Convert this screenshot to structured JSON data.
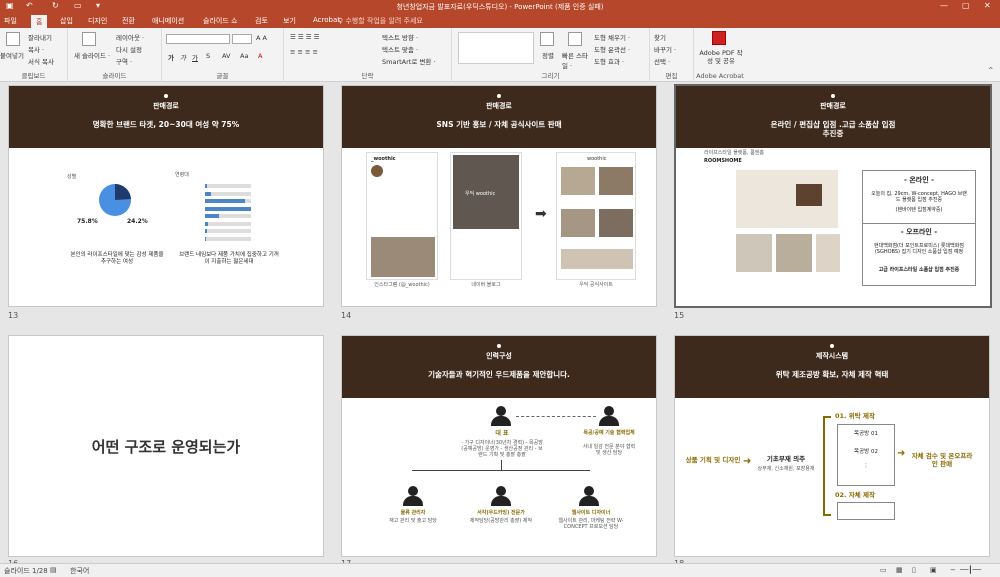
{
  "window": {
    "title": "청년창업자금 발표자료(우딕스튜디오) - PowerPoint (제품 인증 실패)"
  },
  "tabs": [
    "파일",
    "홈",
    "삽입",
    "디자인",
    "전환",
    "애니메이션",
    "슬라이드 쇼",
    "검토",
    "보기",
    "Acrobat"
  ],
  "tell_me": "♀ 수행할 작업을 알려 주세요",
  "ribbon": {
    "clipboard": {
      "cut": "잘라내기",
      "copy": "복사 ·",
      "format_painter": "서식 복사",
      "paste": "붙여넣기",
      "label": "클립보드"
    },
    "slides": {
      "new_slide": "새 슬라이드 ·",
      "layout": "레이아웃 ·",
      "reset": "다시 설정",
      "section": "구역 ·",
      "label": "슬라이드"
    },
    "font": {
      "label": "글꼴"
    },
    "paragraph": {
      "text_direction": "텍스트 방향 ·",
      "align_text": "텍스트 맞춤 ·",
      "smartart": "SmartArt로 변환 ·",
      "label": "단락"
    },
    "drawing": {
      "arrange": "정렬",
      "quick_styles": "빠른 스타일 ·",
      "fill": "도형 채우기 ·",
      "outline": "도형 윤곽선 ·",
      "effects": "도형 효과 ·",
      "label": "그리기"
    },
    "editing": {
      "find": "찾기",
      "replace": "바꾸기 ·",
      "select": "선택 ·",
      "label": "편집"
    },
    "acrobat": {
      "create_pdf": "Adobe PDF 작성 및 공유",
      "label": "Adobe Acrobat"
    }
  },
  "slides": [
    {
      "num": "13",
      "tag": "판매경로",
      "heading": "명확한 브랜드 타겟, 20~30대 여성 약 75%",
      "pie_left": "75.8%",
      "pie_right": "24.2%",
      "caption_left": "본인의 라이프스타일에 맞는 감성 제품을 추구하는 여성",
      "caption_right": "브랜드 네임보다 제품 가치에 집중하고 기꺼이 지출하는 젊은세대",
      "pie_title": "성별",
      "bar_title": "연령대",
      "bar_values": [
        0.02,
        0.05,
        0.35,
        0.4,
        0.12,
        0.03,
        0.02,
        0.01
      ]
    },
    {
      "num": "14",
      "tag": "판매경로",
      "heading": "SNS 기반 홍보 / 자체 공식사이트 판매",
      "cap1": "인스타그램 (@_woothic)",
      "cap2": "네이버 블로그",
      "cap3": "우딕 공식사이트",
      "insta_id": "_woothic",
      "site_name": "woothic",
      "wood_sub": "우딕 woothic"
    },
    {
      "num": "15",
      "tag": "판매경로",
      "heading": "온라인 / 편집샵 입점 .고급 소품샵 입점 추진중",
      "shop": "ROOMSHOME",
      "shop_sub": "라이프스타일 플랫폼, 룸앤홈",
      "online_title": "- 온라인 -",
      "online_body": "오늘의 집, 29cm, W-concept, HAGO 브랜드 플랫폼 입점 추진중",
      "online_note": "(텐바이텐 입점계약중)",
      "offline_title": "- 오프라인 -",
      "offline_body": "현대백화점(더 포인트프로미스) 롯데백화점(SGHOBS) 집기 디자인 소품샵 입점 예정",
      "offline_note": "고급 라이프스타일 소품샵 입점 추진중"
    },
    {
      "num": "16",
      "big": "어떤 구조로 운영되는가"
    },
    {
      "num": "17",
      "tag": "인력구성",
      "heading": "기술자들과 혁기적인 우드제품을 제안합니다.",
      "ceo": "대 표",
      "ceo_desc": "- 가구 디자이너(30년차 경력) - 목공방(공예공방) 운영가 - 생산공정 관리 - 브랜드 기획 및 총괄 총괄",
      "tech": "목공/공예 기술 협력업체",
      "tech_desc": "사내 일감 전문 분야 협력 및 생산 담당",
      "m1": "물류 관리자",
      "m1d": "재고 관리 및 출고 담당",
      "m2": "서각(우드카빙) 전문가",
      "m2d": "제작담당(공방관리 총괄) 제작",
      "m3": "웹사이트 디자이너",
      "m3d": "웹사이트 관리, 마케팅 전략 W-CONCEPT 프로모션 담당"
    },
    {
      "num": "18",
      "tag": "제작시스템",
      "heading": "위탁 제조공방 확보, 자체 제작 혁태",
      "step1": "상품 기획 및 디자인",
      "step2": "기초부재 의주",
      "step2d": "상부재, 신소재원, 포장용재",
      "p1": "01. 위탁 제작",
      "p2": "02. 자체 제작",
      "shop1": "목공방 01",
      "shop2": "목공방 02",
      "result": "자체 검수 및 온오프라인 판매"
    }
  ],
  "status": {
    "slide_count": "슬라이드 1/28",
    "language": "한국어"
  }
}
